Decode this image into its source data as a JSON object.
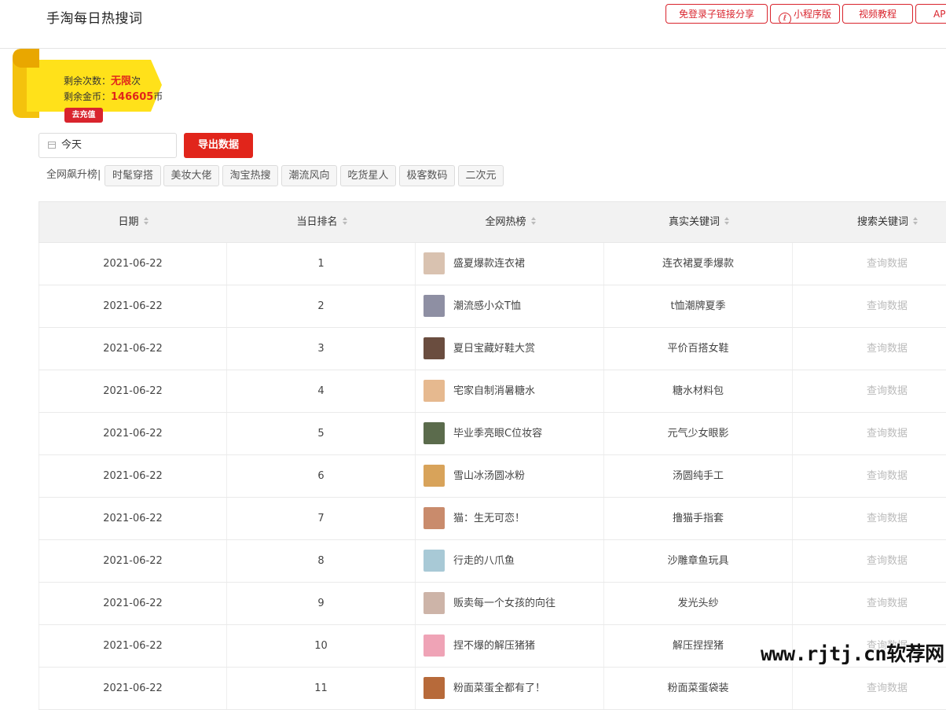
{
  "header": {
    "title": "手淘每日热搜词",
    "buttons": [
      {
        "label": "免登录子链接分享"
      },
      {
        "label": "小程序版",
        "icon": "mini-program-icon"
      },
      {
        "label": "视频教程"
      },
      {
        "label": "API"
      }
    ]
  },
  "account": {
    "remaining_times_label": "剩余次数：",
    "remaining_times_value": "无限",
    "remaining_times_unit": "次",
    "coins_label": "剩余金币：",
    "coins_value": "146605",
    "coins_unit": "币",
    "recharge_label": "去充值"
  },
  "filters": {
    "date_value": "今天",
    "date_icon": "calendar-icon",
    "export_label": "导出数据",
    "tags_label": "全网飙升榜|",
    "tags": [
      "时髦穿搭",
      "美妆大佬",
      "淘宝热搜",
      "潮流风向",
      "吃货星人",
      "极客数码",
      "二次元"
    ]
  },
  "table": {
    "columns": [
      "日期",
      "当日排名",
      "全网热榜",
      "真实关键词",
      "搜索关键词"
    ],
    "query_label": "查询数据",
    "rows": [
      {
        "date": "2021-06-22",
        "rank": "1",
        "hot": "盛夏爆款连衣裙",
        "keyword": "连衣裙夏季爆款",
        "thumb": "#d9c2b0"
      },
      {
        "date": "2021-06-22",
        "rank": "2",
        "hot": "潮流感小众T恤",
        "keyword": "t恤潮牌夏季",
        "thumb": "#8e8fa3"
      },
      {
        "date": "2021-06-22",
        "rank": "3",
        "hot": "夏日宝藏好鞋大赏",
        "keyword": "平价百搭女鞋",
        "thumb": "#6a4d3f"
      },
      {
        "date": "2021-06-22",
        "rank": "4",
        "hot": "宅家自制消暑糖水",
        "keyword": "糖水材料包",
        "thumb": "#e6b98f"
      },
      {
        "date": "2021-06-22",
        "rank": "5",
        "hot": "毕业季亮眼C位妆容",
        "keyword": "元气少女眼影",
        "thumb": "#5b6b4c"
      },
      {
        "date": "2021-06-22",
        "rank": "6",
        "hot": "雪山冰汤圆冰粉",
        "keyword": "汤圆纯手工",
        "thumb": "#d8a35a"
      },
      {
        "date": "2021-06-22",
        "rank": "7",
        "hot": "猫：生无可恋！",
        "keyword": "撸猫手指套",
        "thumb": "#c98b6c"
      },
      {
        "date": "2021-06-22",
        "rank": "8",
        "hot": "行走的八爪鱼",
        "keyword": "沙雕章鱼玩具",
        "thumb": "#a8c9d6"
      },
      {
        "date": "2021-06-22",
        "rank": "9",
        "hot": "贩卖每一个女孩的向往",
        "keyword": "发光头纱",
        "thumb": "#cdb4a8"
      },
      {
        "date": "2021-06-22",
        "rank": "10",
        "hot": "捏不爆的解压猪猪",
        "keyword": "解压捏捏猪",
        "thumb": "#efa3b6"
      },
      {
        "date": "2021-06-22",
        "rank": "11",
        "hot": "粉面菜蛋全都有了！",
        "keyword": "粉面菜蛋袋装",
        "thumb": "#b76a3a"
      }
    ]
  },
  "watermark": "www.rjtj.cn软荐网",
  "colors": {
    "accent": "#e1251b",
    "ribbon": "#ffe11a"
  }
}
